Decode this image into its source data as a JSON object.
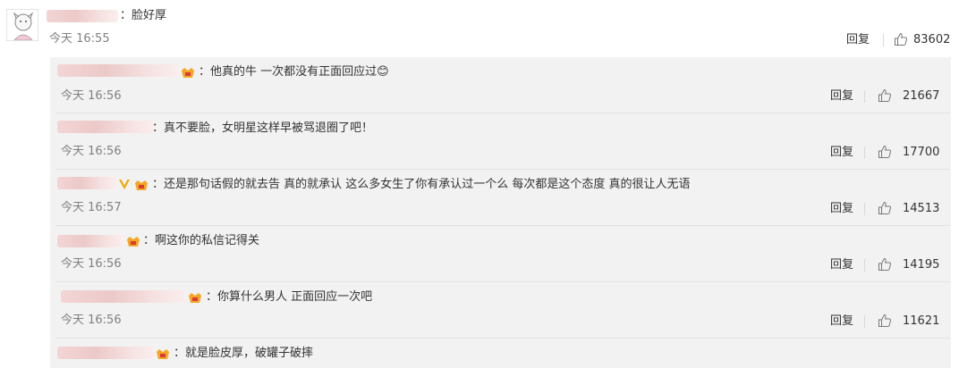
{
  "main_comment": {
    "text": "：脸好厚",
    "time": "今天 16:55",
    "reply_label": "回复",
    "likes": "83602"
  },
  "replies": [
    {
      "text": "：他真的牛 一次都没有正面回应过😊",
      "time": "今天 16:56",
      "reply_label": "回复",
      "likes": "21667"
    },
    {
      "text": "：真不要脸，女明星这样早被骂退圈了吧！",
      "time": "今天 16:56",
      "reply_label": "回复",
      "likes": "17700"
    },
    {
      "text": "：还是那句话假的就去告 真的就承认 这么多女生了你有承认过一个么 每次都是这个态度 真的很让人无语",
      "time": "今天 16:57",
      "reply_label": "回复",
      "likes": "14513"
    },
    {
      "text": "：啊这你的私信记得关",
      "time": "今天 16:56",
      "reply_label": "回复",
      "likes": "14195"
    },
    {
      "text": "：你算什么男人 正面回应一次吧",
      "time": "今天 16:56",
      "reply_label": "回复",
      "likes": "11621"
    },
    {
      "text": "：就是脸皮厚，破罐子破摔"
    }
  ],
  "colors": {
    "reply_bg": "#f2f2f2",
    "muted_text": "#808080",
    "badge_orange": "#f5a623",
    "verified_gold": "#f0a800"
  }
}
